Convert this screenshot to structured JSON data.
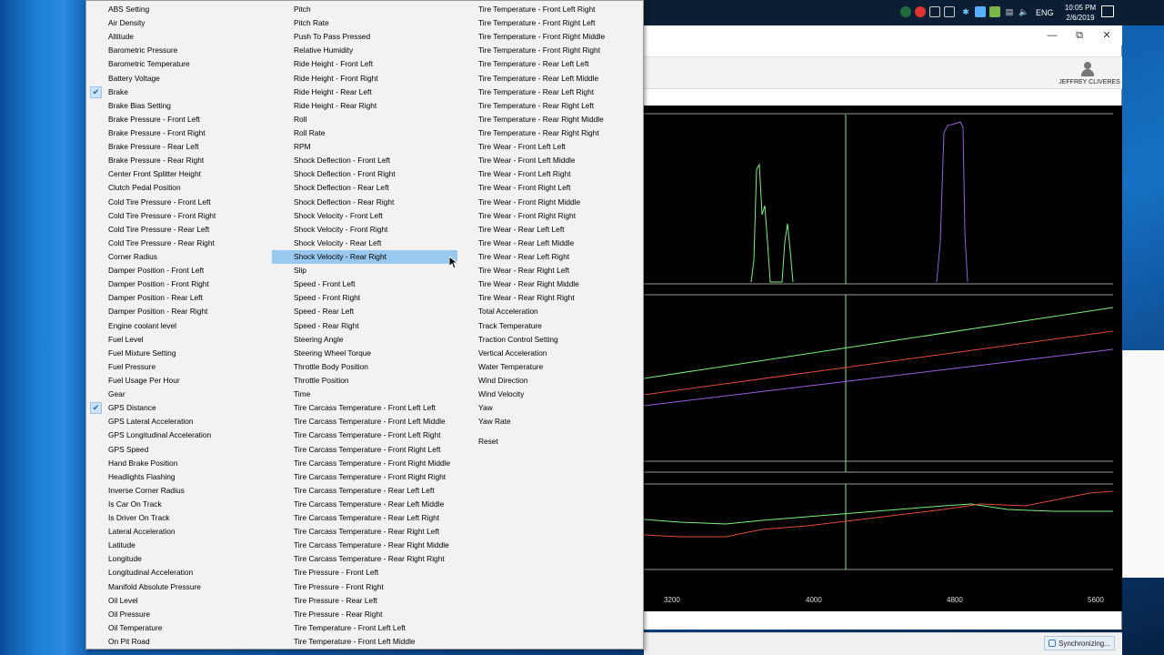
{
  "menu": {
    "columns": [
      {
        "items": [
          {
            "label": "ABS Setting"
          },
          {
            "label": "Air Density"
          },
          {
            "label": "Altitude"
          },
          {
            "label": "Barometric Pressure"
          },
          {
            "label": "Barometric Temperature"
          },
          {
            "label": "Battery Voltage"
          },
          {
            "label": "Brake",
            "checked": true
          },
          {
            "label": "Brake Bias Setting"
          },
          {
            "label": "Brake Pressure - Front Left"
          },
          {
            "label": "Brake Pressure - Front Right"
          },
          {
            "label": "Brake Pressure - Rear Left"
          },
          {
            "label": "Brake Pressure - Rear Right"
          },
          {
            "label": "Center Front Splitter Height"
          },
          {
            "label": "Clutch Pedal Position"
          },
          {
            "label": "Cold Tire Pressure - Front Left"
          },
          {
            "label": "Cold Tire Pressure - Front Right"
          },
          {
            "label": "Cold Tire Pressure - Rear Left"
          },
          {
            "label": "Cold Tire Pressure - Rear Right"
          },
          {
            "label": "Corner Radius"
          },
          {
            "label": "Damper Position - Front Left"
          },
          {
            "label": "Damper Position - Front Right"
          },
          {
            "label": "Damper Position - Rear Left"
          },
          {
            "label": "Damper Position - Rear Right"
          },
          {
            "label": "Engine coolant level"
          },
          {
            "label": "Fuel Level"
          },
          {
            "label": "Fuel Mixture Setting"
          },
          {
            "label": "Fuel Pressure"
          },
          {
            "label": "Fuel Usage Per Hour"
          },
          {
            "label": "Gear"
          },
          {
            "label": "GPS Distance",
            "checked": true
          },
          {
            "label": "GPS Lateral Acceleration"
          },
          {
            "label": "GPS Longitudinal Acceleration"
          },
          {
            "label": "GPS Speed"
          },
          {
            "label": "Hand Brake Position"
          },
          {
            "label": "Headlights Flashing"
          },
          {
            "label": "Inverse Corner Radius"
          },
          {
            "label": "Is Car On Track"
          },
          {
            "label": "Is Driver On Track"
          },
          {
            "label": "Lateral Acceleration"
          },
          {
            "label": "Latitude"
          },
          {
            "label": "Longitude"
          },
          {
            "label": "Longitudinal Acceleration"
          },
          {
            "label": "Manifold Absolute Pressure"
          },
          {
            "label": "Oil Level"
          },
          {
            "label": "Oil Pressure"
          },
          {
            "label": "Oil Temperature"
          },
          {
            "label": "On Pit Road"
          }
        ]
      },
      {
        "items": [
          {
            "label": "Pitch"
          },
          {
            "label": "Pitch Rate"
          },
          {
            "label": "Push To Pass Pressed"
          },
          {
            "label": "Relative Humidity"
          },
          {
            "label": "Ride Height - Front Left"
          },
          {
            "label": "Ride Height - Front Right"
          },
          {
            "label": "Ride Height - Rear Left"
          },
          {
            "label": "Ride Height - Rear Right"
          },
          {
            "label": "Roll"
          },
          {
            "label": "Roll Rate"
          },
          {
            "label": "RPM"
          },
          {
            "label": "Shock Deflection - Front Left"
          },
          {
            "label": "Shock Deflection - Front Right"
          },
          {
            "label": "Shock Deflection - Rear Left"
          },
          {
            "label": "Shock Deflection - Rear Right"
          },
          {
            "label": "Shock Velocity - Front Left"
          },
          {
            "label": "Shock Velocity - Front Right"
          },
          {
            "label": "Shock Velocity - Rear Left"
          },
          {
            "label": "Shock Velocity - Rear Right",
            "highlighted": true
          },
          {
            "label": "Slip"
          },
          {
            "label": "Speed - Front Left"
          },
          {
            "label": "Speed - Front Right"
          },
          {
            "label": "Speed - Rear Left"
          },
          {
            "label": "Speed - Rear Right"
          },
          {
            "label": "Steering Angle"
          },
          {
            "label": "Steering Wheel Torque"
          },
          {
            "label": "Throttle Body Position"
          },
          {
            "label": "Throttle Position"
          },
          {
            "label": "Time"
          },
          {
            "label": "Tire Carcass Temperature - Front Left Left"
          },
          {
            "label": "Tire Carcass Temperature - Front Left Middle"
          },
          {
            "label": "Tire Carcass Temperature - Front Left Right"
          },
          {
            "label": "Tire Carcass Temperature - Front Right Left"
          },
          {
            "label": "Tire Carcass Temperature - Front Right Middle"
          },
          {
            "label": "Tire Carcass Temperature - Front Right Right"
          },
          {
            "label": "Tire Carcass Temperature - Rear Left Left"
          },
          {
            "label": "Tire Carcass Temperature - Rear Left Middle"
          },
          {
            "label": "Tire Carcass Temperature - Rear Left Right"
          },
          {
            "label": "Tire Carcass Temperature - Rear Right Left"
          },
          {
            "label": "Tire Carcass Temperature - Rear Right Middle"
          },
          {
            "label": "Tire Carcass Temperature - Rear Right Right"
          },
          {
            "label": "Tire Pressure - Front Left"
          },
          {
            "label": "Tire Pressure - Front Right"
          },
          {
            "label": "Tire Pressure - Rear Left"
          },
          {
            "label": "Tire Pressure - Rear Right"
          },
          {
            "label": "Tire Temperature - Front Left Left"
          },
          {
            "label": "Tire Temperature - Front Left Middle"
          }
        ]
      },
      {
        "items": [
          {
            "label": "Tire Temperature - Front Left Right"
          },
          {
            "label": "Tire Temperature - Front Right Left"
          },
          {
            "label": "Tire Temperature - Front Right Middle"
          },
          {
            "label": "Tire Temperature - Front Right Right"
          },
          {
            "label": "Tire Temperature - Rear Left Left"
          },
          {
            "label": "Tire Temperature - Rear Left Middle"
          },
          {
            "label": "Tire Temperature - Rear Left Right"
          },
          {
            "label": "Tire Temperature - Rear Right Left"
          },
          {
            "label": "Tire Temperature - Rear Right Middle"
          },
          {
            "label": "Tire Temperature - Rear Right Right"
          },
          {
            "label": "Tire Wear - Front Left Left"
          },
          {
            "label": "Tire Wear - Front Left Middle"
          },
          {
            "label": "Tire Wear - Front Left Right"
          },
          {
            "label": "Tire Wear - Front Right Left"
          },
          {
            "label": "Tire Wear - Front Right Middle"
          },
          {
            "label": "Tire Wear - Front Right Right"
          },
          {
            "label": "Tire Wear - Rear Left Left"
          },
          {
            "label": "Tire Wear - Rear Left Middle"
          },
          {
            "label": "Tire Wear - Rear Left Right"
          },
          {
            "label": "Tire Wear - Rear Right Left"
          },
          {
            "label": "Tire Wear - Rear Right Middle"
          },
          {
            "label": "Tire Wear - Rear Right Right"
          },
          {
            "label": "Total Acceleration"
          },
          {
            "label": "Track Temperature"
          },
          {
            "label": "Traction Control Setting"
          },
          {
            "label": "Vertical Acceleration"
          },
          {
            "label": "Water Temperature"
          },
          {
            "label": "Wind Direction"
          },
          {
            "label": "Wind Velocity"
          },
          {
            "label": "Yaw"
          },
          {
            "label": "Yaw Rate"
          },
          {
            "label": ""
          },
          {
            "label": "Reset"
          }
        ]
      }
    ]
  },
  "tray": {
    "language": "ENG",
    "time": "10:05 PM",
    "date": "2/6/2019",
    "icons": [
      "tray-app-icon",
      "tray-record-icon",
      "tray-display-icon",
      "tray-checkbox-icon",
      "tray-network-icon",
      "tray-app2-icon",
      "tray-battery-icon",
      "tray-wifi-icon",
      "tray-volume-icon"
    ]
  },
  "app": {
    "minimize_glyph": "—",
    "maximize_glyph": "⧉",
    "close_glyph": "✕",
    "user_name": "JEFFREY CLIVERES",
    "sync_status": "Synchronizing...",
    "x_ticks": [
      "3200",
      "4000",
      "4800",
      "5600"
    ],
    "colors": {
      "green": "#7cf07c",
      "red": "#e04a3a",
      "purple": "#9a5ce0",
      "cursor_line": "#7cf07c"
    }
  }
}
